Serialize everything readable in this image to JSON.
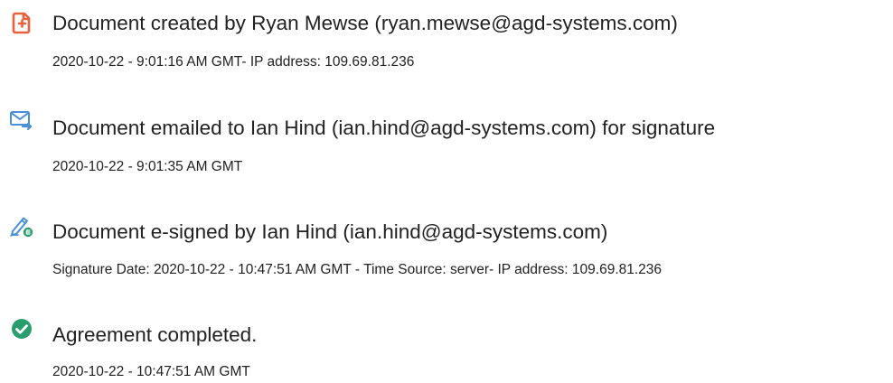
{
  "audit_trail": {
    "events": [
      {
        "icon": "document-created-icon",
        "title": "Document created by Ryan Mewse (ryan.mewse@agd-systems.com)",
        "detail": "2020-10-22 - 9:01:16 AM GMT- IP address: 109.69.81.236"
      },
      {
        "icon": "email-sent-icon",
        "title": "Document emailed to Ian Hind (ian.hind@agd-systems.com) for signature",
        "detail": "2020-10-22 - 9:01:35 AM GMT"
      },
      {
        "icon": "e-signed-pen-icon",
        "title": "Document e-signed by Ian Hind (ian.hind@agd-systems.com)",
        "detail": "Signature Date: 2020-10-22 - 10:47:51 AM GMT - Time Source: server- IP address: 109.69.81.236"
      },
      {
        "icon": "check-circle-icon",
        "title": "Agreement completed.",
        "detail": "2020-10-22 - 10:47:51 AM GMT"
      }
    ]
  },
  "colors": {
    "created_icon": "#e8613a",
    "email_icon": "#4a90d9",
    "signed_icon": "#4a90d9",
    "signed_badge": "#2a9d6e",
    "completed_icon": "#2a9d6e",
    "text": "#222222"
  }
}
